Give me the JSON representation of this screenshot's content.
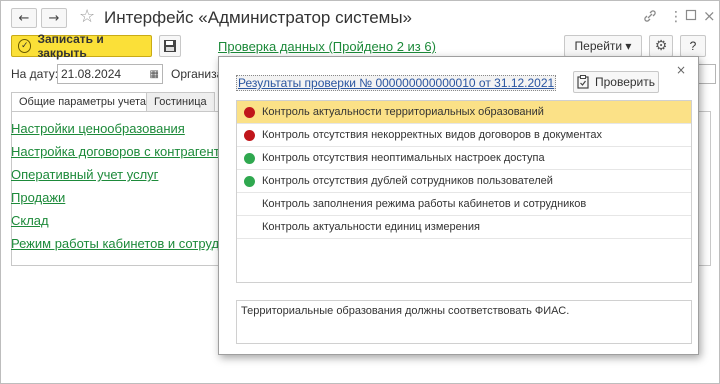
{
  "window": {
    "title": "Интерфейс «Администратор системы»",
    "back_arrow": "←",
    "forward_arrow": "→",
    "star_glyph": "☆",
    "link_glyph": "🔗",
    "menu_glyph": "⋮",
    "restore_glyph": "▫",
    "close_glyph": "×"
  },
  "toolbar": {
    "save_close_label": "Записать и закрыть",
    "save_close_icon": "✓",
    "save_icon_glyph": "💾",
    "check_link": "Проверка данных (Пройдено 2 из 6)",
    "goto_label": "Перейти ▾",
    "gear_glyph": "⚙",
    "help_label": "?"
  },
  "form": {
    "date_label": "На дату:",
    "date_value": "21.08.2024",
    "calendar_glyph": "▦",
    "org_label": "Организация"
  },
  "tabs": [
    {
      "label": "Общие параметры учета"
    },
    {
      "label": "Гостиница"
    }
  ],
  "links": [
    "Настройки ценообразования",
    "Настройка договоров с контрагентами",
    "Оперативный учет услуг",
    "Продажи",
    "Склад",
    "Режим работы кабинетов и сотрудников"
  ],
  "modal": {
    "close_glyph": "×",
    "result_link": "Результаты проверки № 000000000000010 от 31.12.2021",
    "check_button": "Проверить",
    "check_icon": "📋",
    "items": [
      {
        "label": "Контроль актуальности территориальных образований",
        "status": "fail",
        "color": "#c0161b"
      },
      {
        "label": "Контроль отсутствия некорректных видов договоров в документах",
        "status": "fail",
        "color": "#c0161b"
      },
      {
        "label": "Контроль отсутствия неоптимальных настроек доступа",
        "status": "pass",
        "color": "#2fa84f"
      },
      {
        "label": "Контроль отсутствия дублей сотрудников пользователей",
        "status": "pass",
        "color": "#2fa84f"
      },
      {
        "label": "Контроль заполнения режима работы кабинетов и сотрудников",
        "status": "none",
        "color": ""
      },
      {
        "label": "Контроль актуальности единиц измерения",
        "status": "none",
        "color": ""
      }
    ],
    "description": "Территориальные образования должны соответствовать ФИАС."
  },
  "colors": {
    "accent_yellow": "#fbe038",
    "link_green": "#1d8a3a",
    "selected_row": "#fbe187"
  }
}
